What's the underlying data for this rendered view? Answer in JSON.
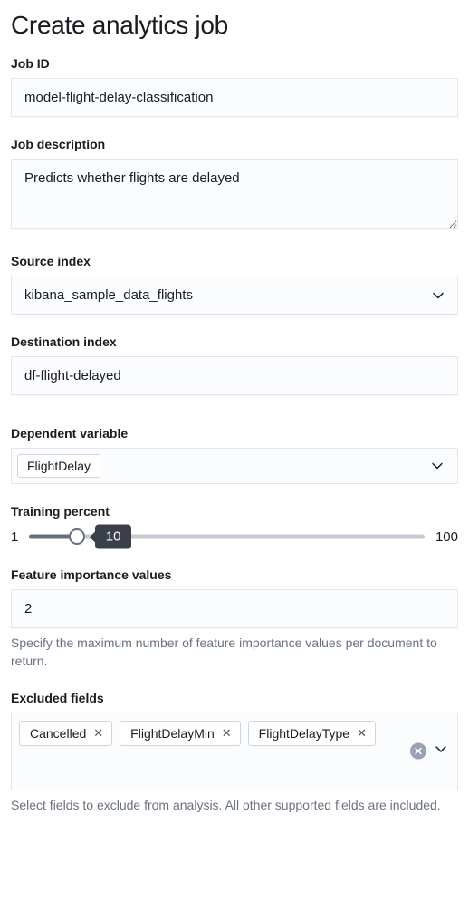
{
  "title": "Create analytics job",
  "jobId": {
    "label": "Job ID",
    "value": "model-flight-delay-classification"
  },
  "jobDescription": {
    "label": "Job description",
    "value": "Predicts whether flights are delayed"
  },
  "sourceIndex": {
    "label": "Source index",
    "value": "kibana_sample_data_flights"
  },
  "destinationIndex": {
    "label": "Destination index",
    "value": "df-flight-delayed"
  },
  "dependentVariable": {
    "label": "Dependent variable",
    "value": "FlightDelay"
  },
  "trainingPercent": {
    "label": "Training percent",
    "min": "1",
    "max": "100",
    "value": "10"
  },
  "featureImportance": {
    "label": "Feature importance values",
    "value": "2",
    "help": "Specify the maximum number of feature importance values per document to return."
  },
  "excludedFields": {
    "label": "Excluded fields",
    "tags": [
      "Cancelled",
      "FlightDelayMin",
      "FlightDelayType"
    ],
    "help": "Select fields to exclude from analysis. All other supported fields are included."
  }
}
